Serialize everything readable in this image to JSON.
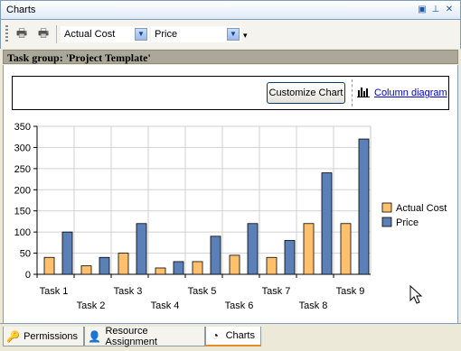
{
  "window": {
    "title": "Charts"
  },
  "toolbar": {
    "combo1_value": "Actual Cost",
    "combo2_value": "Price"
  },
  "group_header": "Task group: 'Project Template'",
  "chart_tools": {
    "customize_label": "Customize Chart",
    "column_diagram_label": "Column diagram"
  },
  "tabs": [
    {
      "label": "Permissions",
      "icon": "permissions-icon"
    },
    {
      "label": "Resource Assignment",
      "icon": "resource-assignment-icon"
    },
    {
      "label": "Charts",
      "icon": "charts-icon",
      "active": true
    }
  ],
  "chart_data": {
    "type": "bar",
    "categories": [
      "Task 1",
      "Task 2",
      "Task 3",
      "Task 4",
      "Task 5",
      "Task 6",
      "Task 7",
      "Task 8",
      "Task 9"
    ],
    "series": [
      {
        "name": "Actual Cost",
        "color": "#ffc06e",
        "values": [
          40,
          20,
          50,
          15,
          30,
          45,
          40,
          120,
          120
        ]
      },
      {
        "name": "Price",
        "color": "#5b7fb7",
        "values": [
          100,
          40,
          120,
          30,
          90,
          120,
          80,
          240,
          320
        ]
      }
    ],
    "ylim": [
      0,
      350
    ],
    "yticks": [
      0,
      50,
      100,
      150,
      200,
      250,
      300,
      350
    ],
    "grid": true,
    "legend": "right"
  }
}
